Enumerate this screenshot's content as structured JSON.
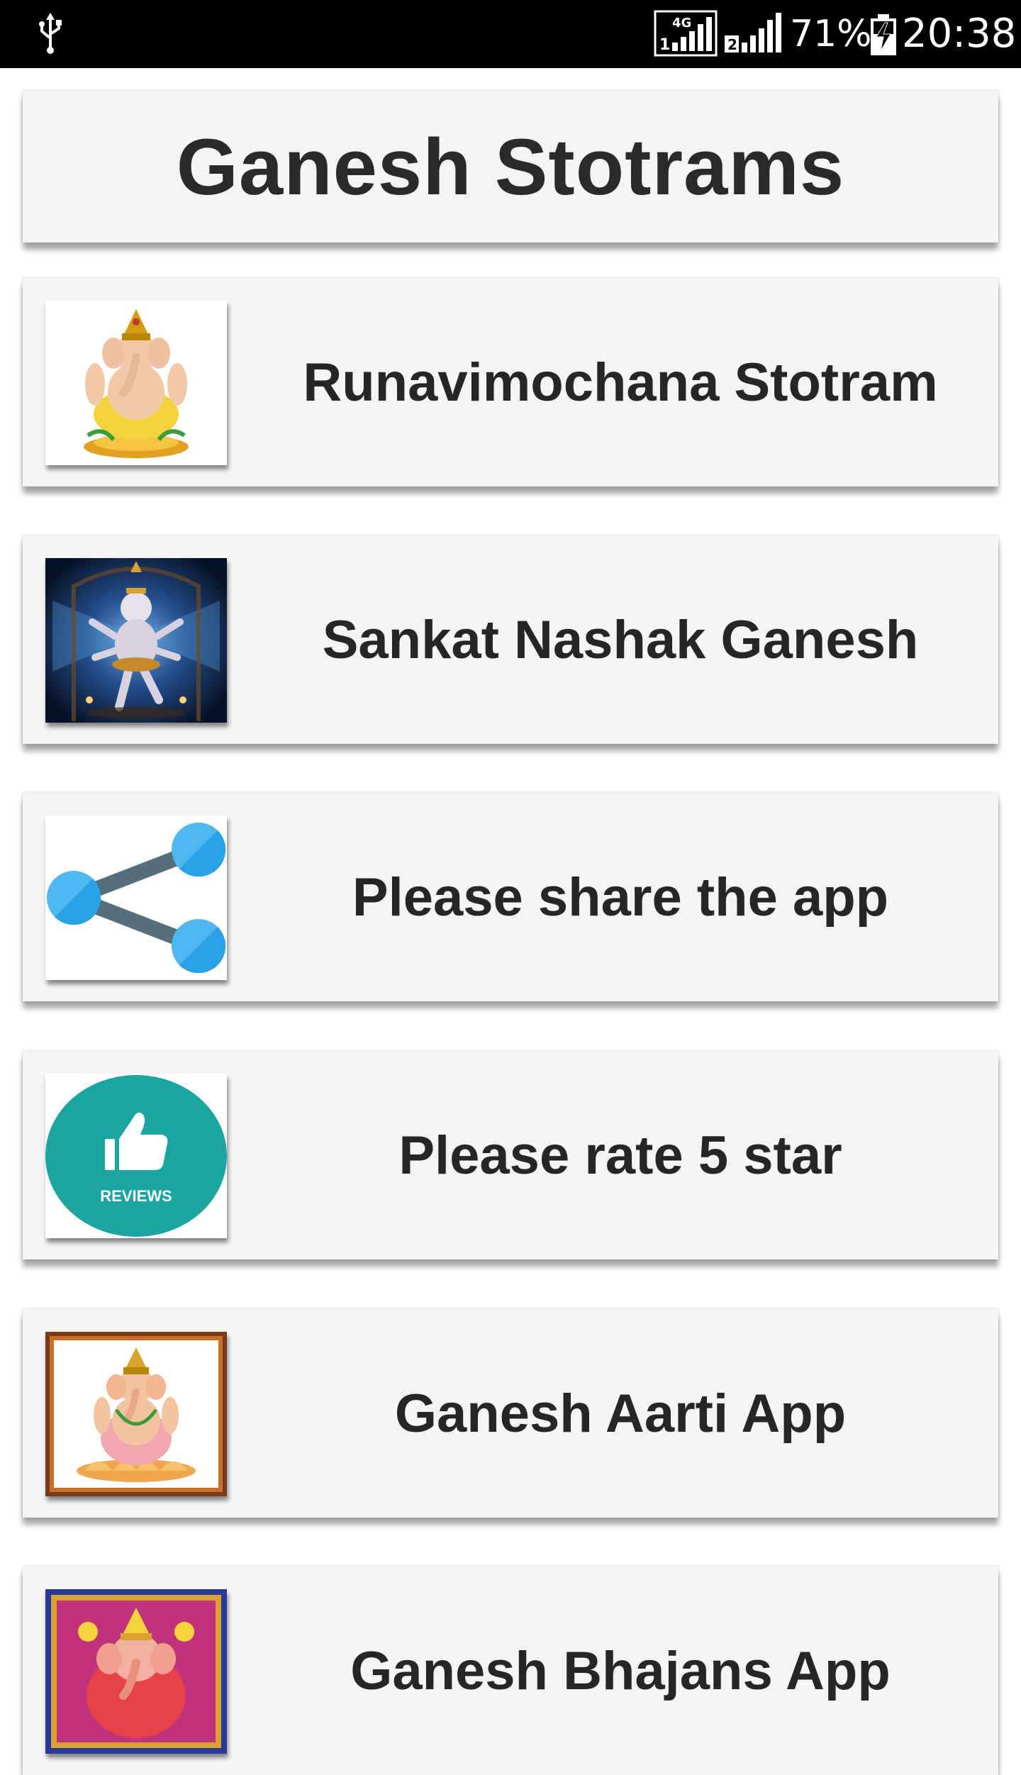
{
  "status_bar": {
    "usb_icon": "usb-icon",
    "network_type": "4G",
    "sim1_label": "1",
    "sim2_label": "2",
    "battery_percent": "71%",
    "battery_icon": "battery-charging-icon",
    "time": "20:38"
  },
  "header": {
    "title": "Ganesh Stotrams"
  },
  "menu": {
    "items": [
      {
        "label": "Runavimochana Stotram",
        "icon": "ganesha-image"
      },
      {
        "label": "Sankat Nashak Ganesh",
        "icon": "ganesha-dancing-image"
      },
      {
        "label": "Please share the app",
        "icon": "share-icon"
      },
      {
        "label": "Please rate 5 star",
        "icon": "reviews-thumbs-up-icon",
        "badge_text": "REVIEWS"
      },
      {
        "label": "Ganesh Aarti App",
        "icon": "ganesha-framed-image"
      },
      {
        "label": "Ganesh Bhajans App",
        "icon": "ganesha-colorful-image"
      }
    ]
  },
  "colors": {
    "status_bar_bg": "#000000",
    "card_bg": "#f4f4f4",
    "text_dark": "#262626",
    "share_blue": "#4db8ef",
    "share_line": "#546e7a",
    "reviews_teal": "#1ba5a0"
  }
}
